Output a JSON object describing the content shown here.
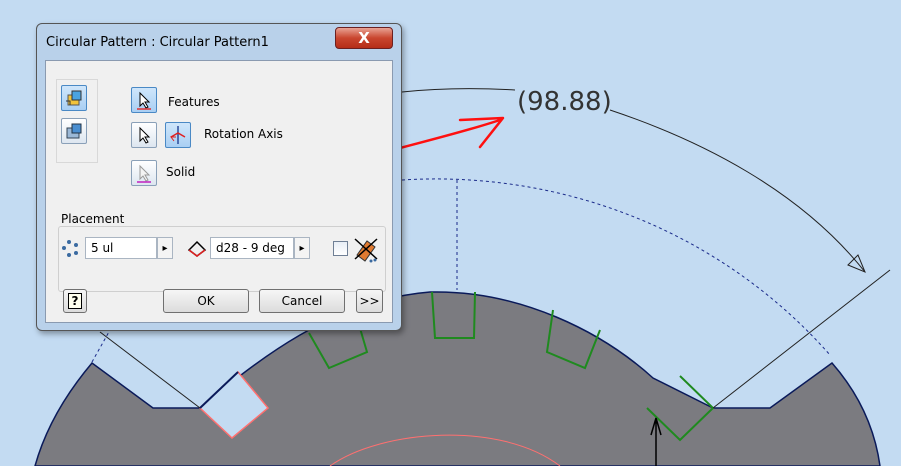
{
  "dialog": {
    "title": "Circular Pattern : Circular Pattern1",
    "close_glyph": "X",
    "features_label": "Features",
    "rotation_axis_label": "Rotation Axis",
    "solid_label": "Solid",
    "placement_label": "Placement",
    "count_value": "5 ul",
    "angle_value": "d28 - 9 deg",
    "spin_glyph": "▸",
    "help_glyph": "?",
    "ok_label": "OK",
    "cancel_label": "Cancel",
    "more_label": ">>"
  },
  "viewport": {
    "dimension_text": "(98.88)"
  },
  "colors": {
    "background": "#c3dbf2",
    "part_fill": "#7b7b80",
    "slot_edges": "#1f8a1f",
    "annotation": "#ff1010"
  },
  "icons": [
    "pattern-individual-features-icon",
    "pattern-solid-icon",
    "select-arrow-icon",
    "flip-axis-icon",
    "count-icon",
    "angle-icon",
    "midplane-icon",
    "help-icon"
  ]
}
